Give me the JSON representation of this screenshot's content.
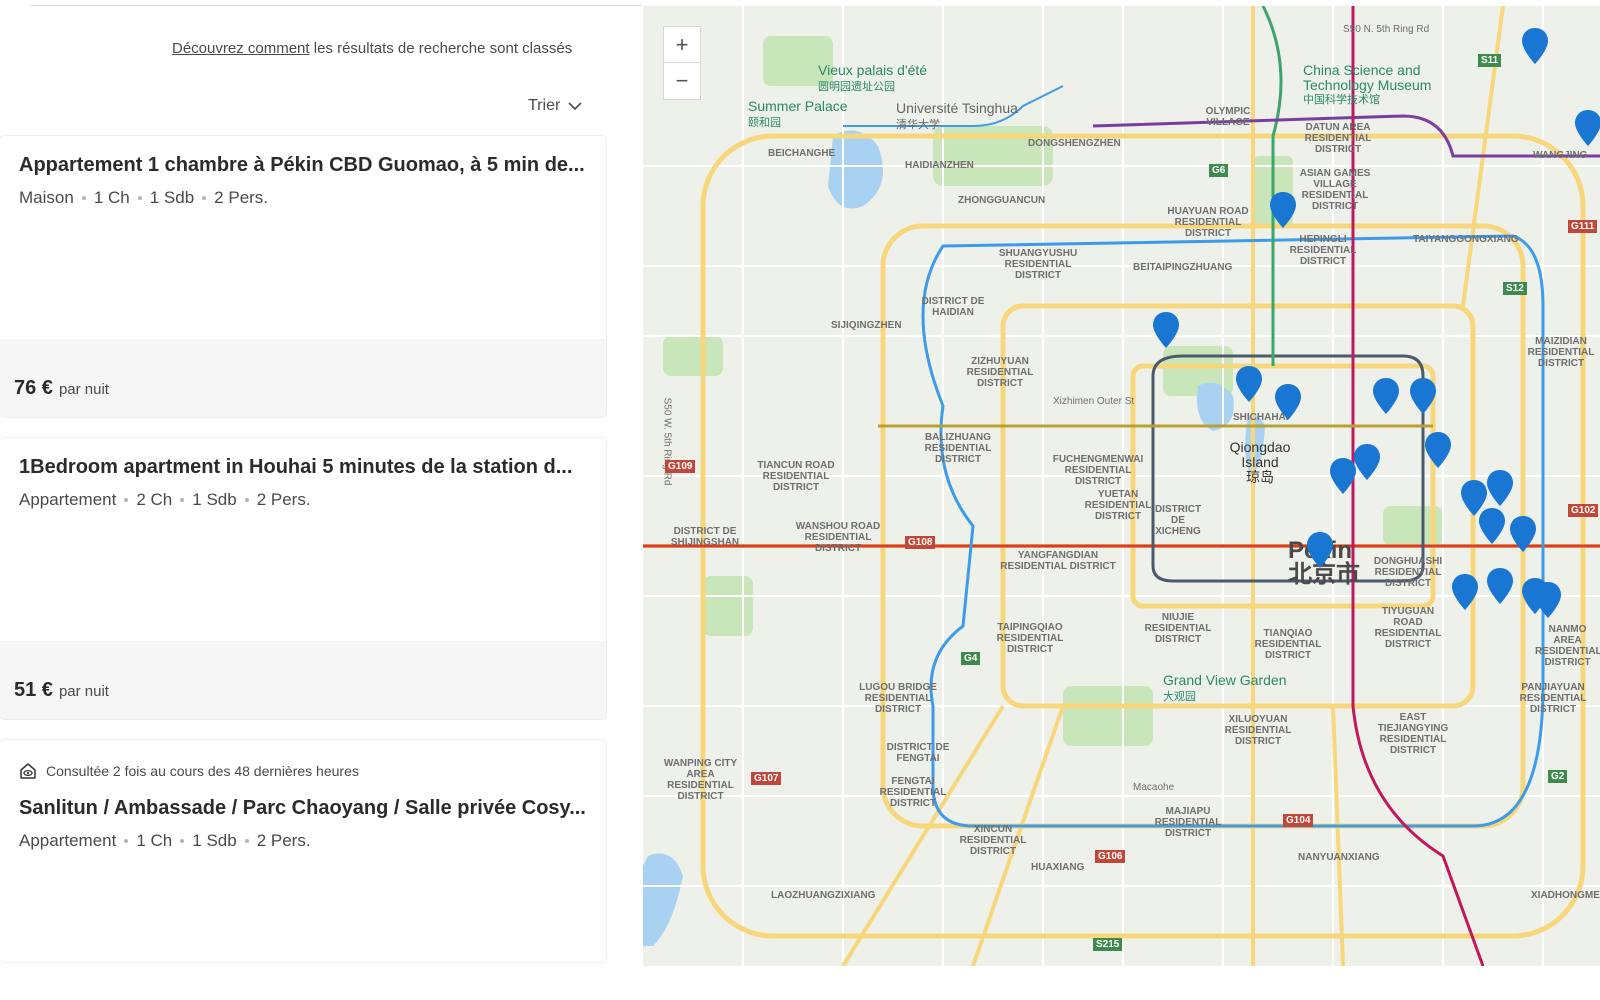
{
  "header": {
    "ranking_link": "Découvrez comment",
    "ranking_text": "les résultats de recherche sont classés",
    "sort_label": "Trier"
  },
  "listings": [
    {
      "title": "Appartement 1 chambre à Pékin CBD Guomao, à 5 min de...",
      "type": "Maison",
      "bedrooms": "1 Ch",
      "bathrooms": "1 Sdb",
      "guests": "2 Pers.",
      "price": "76 €",
      "price_unit": "par nuit"
    },
    {
      "title": "1Bedroom apartment in Houhai 5 minutes de la station d...",
      "type": "Appartement",
      "bedrooms": "2 Ch",
      "bathrooms": "1 Sdb",
      "guests": "2 Pers.",
      "price": "51 €",
      "price_unit": "par nuit"
    },
    {
      "viewed_note": "Consultée 2 fois au cours des 48 dernières heures",
      "title": "Sanlitun / Ambassade / Parc Chaoyang / Salle privée Cosy...",
      "type": "Appartement",
      "bedrooms": "1 Ch",
      "bathrooms": "1 Sdb",
      "guests": "2 Pers."
    }
  ],
  "map": {
    "zoom_in": "+",
    "zoom_out": "−",
    "city_fr": "Pékin",
    "city_zh": "北京市",
    "places": [
      {
        "name": "Vieux palais d'été",
        "zh": "圆明园遗址公园"
      },
      {
        "name": "Summer Palace",
        "zh": "颐和园"
      },
      {
        "name": "Université Tsinghua",
        "zh": "清华大学"
      },
      {
        "name": "China Science and Technology Museum",
        "zh": "中国科学技术馆"
      },
      {
        "name": "Qiongdao Island",
        "zh": "琼岛"
      },
      {
        "name": "Grand View Garden",
        "zh": "大观园"
      }
    ],
    "districts": [
      "HAIDIANZHEN",
      "ZHONGGUANCUN",
      "SHUANGYUSHU RESIDENTIAL DISTRICT",
      "DISTRICT DE HAIDIAN",
      "ZIZHUYUAN RESIDENTIAL DISTRICT",
      "BALIZHUANG RESIDENTIAL DISTRICT",
      "TIANCUN ROAD RESIDENTIAL DISTRICT",
      "WANSHOU ROAD RESIDENTIAL DISTRICT",
      "FUCHENGMENWAI RESIDENTIAL DISTRICT",
      "YUETAN RESIDENTIAL DISTRICT",
      "DISTRICT DE XICHENG",
      "YANGFANGDIAN RESIDENTIAL DISTRICT",
      "HUAYUAN ROAD RESIDENTIAL DISTRICT",
      "HEPINGLI RESIDENTIAL DISTRICT",
      "DATUN AREA RESIDENTIAL DISTRICT",
      "TAIYANGGONGXIANG",
      "SHICHAHAI",
      "BEITAIPINGZHUANG",
      "DONGHUASHI RESIDENTIAL DISTRICT",
      "TIANQIAO RESIDENTIAL DISTRICT",
      "NIUJIE RESIDENTIAL DISTRICT",
      "XILUOYUAN RESIDENTIAL DISTRICT",
      "MAJIAPU RESIDENTIAL DISTRICT",
      "NANYUANXIANG",
      "HUAXIANG",
      "LAOZHUANGZIXIANG",
      "XINCUN RESIDENTIAL DISTRICT",
      "FENGTAI RESIDENTIAL DISTRICT",
      "DISTRICT DE FENGTAI",
      "LUGOU BRIDGE RESIDENTIAL DISTRICT",
      "TAIPINGQIAO RESIDENTIAL DISTRICT",
      "WANPING CITY AREA RESIDENTIAL DISTRICT",
      "DISTRICT DE SHIJINGSHAN",
      "SIJIQINGZHEN",
      "DONGSHENGZHEN",
      "BEICHANGHE",
      "PANJIAYUAN RESIDENTIAL DISTRICT",
      "EAST TIEJIANGYING RESIDENTIAL DISTRICT",
      "TIYUGUAN ROAD RESIDENTIAL DISTRICT",
      "MAIZIDIAN RESIDENTIAL DISTRICT",
      "XIADHONGMEN",
      "WANGJING",
      "NANMO AREA RESIDENTIAL DISTRICT",
      "OLYMPIC VILLAGE",
      "ASIAN GAMES VILLAGE RESIDENTIAL DISTRICT",
      "Macaohe",
      "Xizhimen Outer St",
      "S50 N. 5th Ring Rd",
      "S50 W. 5th Ring Rd"
    ],
    "road_shields": [
      "G6",
      "S11",
      "S12",
      "G109",
      "G108",
      "G4",
      "G107",
      "G106",
      "G104",
      "G102",
      "G2",
      "S215",
      "G111"
    ],
    "colors": {
      "land": "#eef0ea",
      "park": "#c8e6b9",
      "water": "#a8d1f2",
      "highway": "#f8d77c",
      "road": "#ffffff",
      "marker": "#1976d2",
      "line_red": "#d93a2a",
      "line_blue": "#3d9be9",
      "line_green": "#3da56a",
      "line_purple": "#7a3ea0",
      "line_magenta": "#c2185b",
      "line_grey": "#4a5a6a"
    }
  }
}
